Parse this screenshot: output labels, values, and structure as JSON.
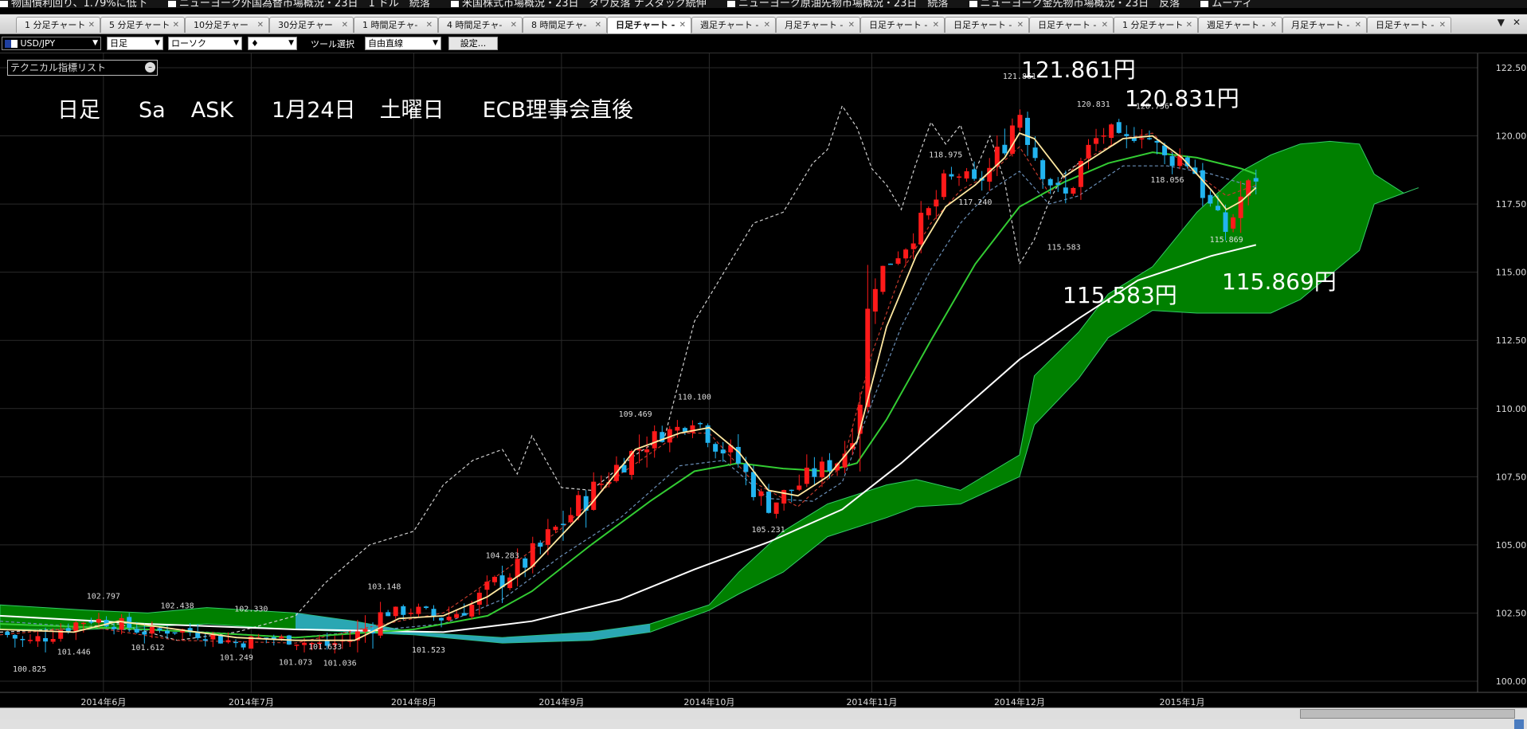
{
  "ticker": [
    "物国債利回り、1.79%に低下",
    "ニューヨーク外国為替市場概況・23日　1 ドル　続落",
    "米国株式市場概況・23日　ダウ反落 ナスダック続伸",
    "ニューヨーク原油先物市場概況・23日　続落",
    "ニューヨーク金先物市場概況・23日　反落",
    "ムーディ"
  ],
  "tabs": [
    {
      "label": "1 分足チャート"
    },
    {
      "label": "5 分足チャート"
    },
    {
      "label": "10分足チャー"
    },
    {
      "label": "30分足チャー"
    },
    {
      "label": "1 時間足チャ-"
    },
    {
      "label": "4 時間足チャ-"
    },
    {
      "label": "8 時間足チャ-"
    },
    {
      "label": "日足チャート -",
      "active": true
    },
    {
      "label": "週足チャート -"
    },
    {
      "label": "月足チャート -"
    },
    {
      "label": "日足チャート -"
    },
    {
      "label": "日足チャート -"
    },
    {
      "label": "日足チャート -"
    },
    {
      "label": "1 分足チャート"
    },
    {
      "label": "週足チャート -"
    },
    {
      "label": "月足チャート -"
    },
    {
      "label": "日足チャート -"
    }
  ],
  "toolbar": {
    "symbol": "USD/JPY",
    "timeframe": "日足",
    "chart_type": "ローソク",
    "tool_label": "ツール選択",
    "tool_value": "自由直線",
    "settings_button": "設定..."
  },
  "indicator_panel": {
    "title": "テクニカル指標リスト"
  },
  "annotation": {
    "timeframe": "日足",
    "day": "Sa",
    "side": "ASK",
    "date": "1月24日",
    "weekday": "土曜日",
    "note": "ECB理事会直後"
  },
  "big_labels": {
    "high1": "121.861円",
    "high2": "120.831円",
    "low1": "115.583円",
    "low2": "115.869円"
  },
  "colors": {
    "bull": "#ff1a1a",
    "bear": "#22b4f0",
    "cloud_bull": "#008000",
    "cloud_bear": "#2aa7b3",
    "ma_short": "#ffe8a0",
    "ma_mid": "#33cc33",
    "ma_long": "#ffffff"
  },
  "chart_data": {
    "type": "candlestick",
    "instrument": "USD/JPY",
    "timeframe": "daily",
    "y_ticks": [
      "122.50",
      "120.00",
      "117.50",
      "115.00",
      "112.50",
      "110.00",
      "107.50",
      "105.00",
      "102.50",
      "100.00"
    ],
    "ylim": [
      100.0,
      122.5
    ],
    "x_ticks": [
      "2014年6月",
      "2014年7月",
      "2014年8月",
      "2014年9月",
      "2014年10月",
      "2014年11月",
      "2014年12月",
      "2015年1月"
    ],
    "x_tick_pos": [
      0.07,
      0.17,
      0.28,
      0.38,
      0.48,
      0.59,
      0.69,
      0.8
    ],
    "price_labels": [
      {
        "text": "100.825",
        "x": 0.02,
        "y": 100.825
      },
      {
        "text": "101.446",
        "x": 0.05,
        "y": 101.446
      },
      {
        "text": "102.797",
        "x": 0.07,
        "y": 102.797
      },
      {
        "text": "101.612",
        "x": 0.1,
        "y": 101.612
      },
      {
        "text": "102.438",
        "x": 0.12,
        "y": 102.438
      },
      {
        "text": "101.249",
        "x": 0.16,
        "y": 101.249
      },
      {
        "text": "102.330",
        "x": 0.17,
        "y": 102.33
      },
      {
        "text": "101.073",
        "x": 0.2,
        "y": 101.073
      },
      {
        "text": "101.633",
        "x": 0.22,
        "y": 101.633
      },
      {
        "text": "101.036",
        "x": 0.23,
        "y": 101.036
      },
      {
        "text": "103.148",
        "x": 0.26,
        "y": 103.148
      },
      {
        "text": "101.523",
        "x": 0.29,
        "y": 101.523
      },
      {
        "text": "104.283",
        "x": 0.34,
        "y": 104.283
      },
      {
        "text": "109.469",
        "x": 0.43,
        "y": 109.469
      },
      {
        "text": "110.100",
        "x": 0.47,
        "y": 110.1
      },
      {
        "text": "105.231",
        "x": 0.52,
        "y": 105.231
      },
      {
        "text": "118.975",
        "x": 0.64,
        "y": 118.975
      },
      {
        "text": "117.240",
        "x": 0.66,
        "y": 117.24
      },
      {
        "text": "121.861",
        "x": 0.69,
        "y": 121.861
      },
      {
        "text": "115.583",
        "x": 0.72,
        "y": 115.583
      },
      {
        "text": "120.831",
        "x": 0.74,
        "y": 120.831
      },
      {
        "text": "120.756",
        "x": 0.78,
        "y": 120.756
      },
      {
        "text": "118.056",
        "x": 0.79,
        "y": 118.056
      },
      {
        "text": "115.869",
        "x": 0.83,
        "y": 115.869
      }
    ],
    "close_path": [
      [
        0.0,
        101.8
      ],
      [
        0.02,
        101.4
      ],
      [
        0.04,
        101.9
      ],
      [
        0.06,
        102.3
      ],
      [
        0.08,
        102.1
      ],
      [
        0.1,
        101.8
      ],
      [
        0.12,
        101.9
      ],
      [
        0.14,
        101.7
      ],
      [
        0.16,
        101.4
      ],
      [
        0.18,
        101.6
      ],
      [
        0.2,
        101.5
      ],
      [
        0.22,
        101.3
      ],
      [
        0.24,
        101.6
      ],
      [
        0.26,
        102.5
      ],
      [
        0.28,
        102.6
      ],
      [
        0.3,
        102.3
      ],
      [
        0.32,
        102.8
      ],
      [
        0.34,
        103.8
      ],
      [
        0.36,
        104.5
      ],
      [
        0.38,
        105.8
      ],
      [
        0.4,
        106.9
      ],
      [
        0.42,
        108.0
      ],
      [
        0.44,
        108.9
      ],
      [
        0.46,
        109.3
      ],
      [
        0.47,
        109.7
      ],
      [
        0.48,
        109.0
      ],
      [
        0.5,
        108.0
      ],
      [
        0.51,
        107.1
      ],
      [
        0.52,
        106.4
      ],
      [
        0.53,
        106.8
      ],
      [
        0.55,
        107.6
      ],
      [
        0.57,
        108.2
      ],
      [
        0.58,
        110.0
      ],
      [
        0.59,
        114.5
      ],
      [
        0.6,
        115.3
      ],
      [
        0.61,
        115.8
      ],
      [
        0.62,
        116.6
      ],
      [
        0.63,
        117.3
      ],
      [
        0.64,
        118.3
      ],
      [
        0.65,
        118.6
      ],
      [
        0.66,
        118.2
      ],
      [
        0.67,
        118.8
      ],
      [
        0.68,
        119.8
      ],
      [
        0.69,
        121.0
      ],
      [
        0.7,
        119.4
      ],
      [
        0.71,
        118.4
      ],
      [
        0.72,
        117.6
      ],
      [
        0.73,
        118.8
      ],
      [
        0.74,
        119.8
      ],
      [
        0.75,
        120.2
      ],
      [
        0.76,
        119.6
      ],
      [
        0.77,
        120.3
      ],
      [
        0.78,
        119.8
      ],
      [
        0.79,
        119.0
      ],
      [
        0.8,
        119.3
      ],
      [
        0.81,
        118.6
      ],
      [
        0.82,
        117.2
      ],
      [
        0.83,
        116.5
      ],
      [
        0.84,
        117.8
      ],
      [
        0.85,
        118.5
      ]
    ],
    "ma_short": [
      [
        0.0,
        101.9
      ],
      [
        0.05,
        101.8
      ],
      [
        0.08,
        102.2
      ],
      [
        0.12,
        101.9
      ],
      [
        0.16,
        101.6
      ],
      [
        0.2,
        101.5
      ],
      [
        0.24,
        101.5
      ],
      [
        0.27,
        102.3
      ],
      [
        0.3,
        102.4
      ],
      [
        0.33,
        103.1
      ],
      [
        0.36,
        104.2
      ],
      [
        0.4,
        106.5
      ],
      [
        0.43,
        108.5
      ],
      [
        0.46,
        109.1
      ],
      [
        0.48,
        109.3
      ],
      [
        0.5,
        108.4
      ],
      [
        0.52,
        107.0
      ],
      [
        0.54,
        106.8
      ],
      [
        0.56,
        107.5
      ],
      [
        0.58,
        108.8
      ],
      [
        0.6,
        113.0
      ],
      [
        0.62,
        115.6
      ],
      [
        0.64,
        117.4
      ],
      [
        0.66,
        118.2
      ],
      [
        0.68,
        119.2
      ],
      [
        0.69,
        120.1
      ],
      [
        0.7,
        119.9
      ],
      [
        0.72,
        118.5
      ],
      [
        0.74,
        119.2
      ],
      [
        0.76,
        119.9
      ],
      [
        0.78,
        120.0
      ],
      [
        0.8,
        119.2
      ],
      [
        0.82,
        118.0
      ],
      [
        0.83,
        117.3
      ],
      [
        0.84,
        117.6
      ],
      [
        0.85,
        118.1
      ]
    ],
    "ma_mid": [
      [
        0.0,
        102.1
      ],
      [
        0.1,
        101.9
      ],
      [
        0.2,
        101.6
      ],
      [
        0.28,
        101.9
      ],
      [
        0.33,
        102.4
      ],
      [
        0.36,
        103.3
      ],
      [
        0.4,
        105.0
      ],
      [
        0.44,
        106.6
      ],
      [
        0.47,
        107.7
      ],
      [
        0.5,
        108.0
      ],
      [
        0.53,
        107.8
      ],
      [
        0.56,
        107.7
      ],
      [
        0.58,
        108.0
      ],
      [
        0.6,
        109.6
      ],
      [
        0.63,
        112.5
      ],
      [
        0.66,
        115.3
      ],
      [
        0.69,
        117.4
      ],
      [
        0.72,
        118.3
      ],
      [
        0.75,
        119.0
      ],
      [
        0.78,
        119.4
      ],
      [
        0.81,
        119.2
      ],
      [
        0.84,
        118.8
      ],
      [
        0.85,
        118.6
      ]
    ],
    "ma_long": [
      [
        0.0,
        102.4
      ],
      [
        0.1,
        102.1
      ],
      [
        0.2,
        101.9
      ],
      [
        0.3,
        101.8
      ],
      [
        0.36,
        102.2
      ],
      [
        0.42,
        103.0
      ],
      [
        0.47,
        104.1
      ],
      [
        0.52,
        105.1
      ],
      [
        0.57,
        106.3
      ],
      [
        0.61,
        108.0
      ],
      [
        0.65,
        109.9
      ],
      [
        0.69,
        111.8
      ],
      [
        0.73,
        113.3
      ],
      [
        0.77,
        114.7
      ],
      [
        0.82,
        115.6
      ],
      [
        0.85,
        116.0
      ]
    ],
    "cloud_top": [
      [
        0.0,
        102.8
      ],
      [
        0.06,
        102.6
      ],
      [
        0.1,
        102.5
      ],
      [
        0.14,
        102.7
      ],
      [
        0.2,
        102.5
      ],
      [
        0.24,
        102.2
      ],
      [
        0.28,
        101.8
      ],
      [
        0.34,
        101.6
      ],
      [
        0.4,
        101.8
      ],
      [
        0.44,
        102.1
      ],
      [
        0.48,
        102.8
      ],
      [
        0.5,
        104.0
      ],
      [
        0.53,
        105.5
      ],
      [
        0.56,
        106.5
      ],
      [
        0.6,
        107.2
      ],
      [
        0.62,
        107.4
      ],
      [
        0.65,
        107.0
      ],
      [
        0.69,
        108.3
      ],
      [
        0.7,
        111.2
      ],
      [
        0.73,
        112.8
      ],
      [
        0.75,
        114.2
      ],
      [
        0.78,
        115.2
      ],
      [
        0.81,
        117.2
      ],
      [
        0.84,
        118.7
      ],
      [
        0.86,
        119.3
      ],
      [
        0.88,
        119.7
      ],
      [
        0.9,
        119.8
      ],
      [
        0.92,
        119.7
      ],
      [
        0.93,
        118.6
      ],
      [
        0.95,
        117.9
      ],
      [
        0.96,
        118.1
      ]
    ],
    "cloud_bottom": [
      [
        0.0,
        101.9
      ],
      [
        0.06,
        101.9
      ],
      [
        0.1,
        102.0
      ],
      [
        0.14,
        102.1
      ],
      [
        0.2,
        101.9
      ],
      [
        0.24,
        101.8
      ],
      [
        0.28,
        101.7
      ],
      [
        0.34,
        101.4
      ],
      [
        0.4,
        101.5
      ],
      [
        0.44,
        101.8
      ],
      [
        0.48,
        102.6
      ],
      [
        0.5,
        103.2
      ],
      [
        0.53,
        104.0
      ],
      [
        0.56,
        105.3
      ],
      [
        0.6,
        106.0
      ],
      [
        0.62,
        106.4
      ],
      [
        0.65,
        106.5
      ],
      [
        0.69,
        107.5
      ],
      [
        0.7,
        109.4
      ],
      [
        0.73,
        111.1
      ],
      [
        0.75,
        112.6
      ],
      [
        0.78,
        113.6
      ],
      [
        0.81,
        113.5
      ],
      [
        0.84,
        113.5
      ],
      [
        0.86,
        113.5
      ],
      [
        0.88,
        114.0
      ],
      [
        0.9,
        114.9
      ],
      [
        0.92,
        115.8
      ],
      [
        0.93,
        117.5
      ],
      [
        0.95,
        117.9
      ],
      [
        0.96,
        118.1
      ]
    ],
    "lagging_span": [
      [
        0.0,
        101.8
      ],
      [
        0.04,
        101.9
      ],
      [
        0.08,
        102.1
      ],
      [
        0.12,
        101.5
      ],
      [
        0.16,
        101.8
      ],
      [
        0.2,
        102.4
      ],
      [
        0.22,
        103.6
      ],
      [
        0.25,
        105.0
      ],
      [
        0.28,
        105.5
      ],
      [
        0.3,
        107.2
      ],
      [
        0.32,
        108.1
      ],
      [
        0.34,
        108.5
      ],
      [
        0.35,
        107.6
      ],
      [
        0.36,
        109.0
      ],
      [
        0.38,
        107.1
      ],
      [
        0.4,
        107.0
      ],
      [
        0.43,
        108.3
      ],
      [
        0.45,
        109.0
      ],
      [
        0.47,
        113.2
      ],
      [
        0.49,
        115.0
      ],
      [
        0.51,
        116.8
      ],
      [
        0.53,
        117.2
      ],
      [
        0.55,
        119.0
      ],
      [
        0.56,
        119.5
      ],
      [
        0.57,
        121.1
      ],
      [
        0.58,
        120.3
      ],
      [
        0.59,
        118.8
      ],
      [
        0.6,
        118.2
      ],
      [
        0.61,
        117.3
      ],
      [
        0.62,
        119.0
      ],
      [
        0.63,
        120.5
      ],
      [
        0.64,
        119.7
      ],
      [
        0.65,
        120.4
      ],
      [
        0.66,
        118.7
      ],
      [
        0.67,
        120.0
      ],
      [
        0.68,
        118.3
      ],
      [
        0.69,
        115.3
      ],
      [
        0.7,
        116.2
      ],
      [
        0.71,
        117.6
      ],
      [
        0.72,
        118.6
      ],
      [
        0.73,
        119.0
      ]
    ],
    "baseline": [
      [
        0.0,
        102.2
      ],
      [
        0.08,
        101.9
      ],
      [
        0.14,
        101.8
      ],
      [
        0.2,
        101.6
      ],
      [
        0.26,
        101.9
      ],
      [
        0.3,
        102.1
      ],
      [
        0.34,
        103.0
      ],
      [
        0.38,
        104.6
      ],
      [
        0.42,
        106.0
      ],
      [
        0.46,
        107.9
      ],
      [
        0.49,
        108.1
      ],
      [
        0.52,
        106.7
      ],
      [
        0.55,
        106.6
      ],
      [
        0.57,
        107.3
      ],
      [
        0.59,
        110.2
      ],
      [
        0.61,
        113.0
      ],
      [
        0.63,
        115.1
      ],
      [
        0.65,
        116.8
      ],
      [
        0.67,
        118.0
      ],
      [
        0.69,
        118.7
      ],
      [
        0.71,
        117.5
      ],
      [
        0.73,
        117.8
      ],
      [
        0.76,
        118.9
      ],
      [
        0.79,
        118.9
      ],
      [
        0.82,
        118.6
      ],
      [
        0.85,
        118.1
      ]
    ],
    "conversion": [
      [
        0.0,
        101.7
      ],
      [
        0.06,
        102.0
      ],
      [
        0.12,
        101.5
      ],
      [
        0.2,
        101.4
      ],
      [
        0.26,
        102.1
      ],
      [
        0.3,
        102.5
      ],
      [
        0.34,
        104.0
      ],
      [
        0.38,
        105.6
      ],
      [
        0.42,
        107.6
      ],
      [
        0.46,
        109.1
      ],
      [
        0.48,
        109.1
      ],
      [
        0.51,
        107.3
      ],
      [
        0.54,
        106.4
      ],
      [
        0.57,
        107.9
      ],
      [
        0.59,
        112.0
      ],
      [
        0.61,
        115.0
      ],
      [
        0.63,
        116.8
      ],
      [
        0.65,
        118.0
      ],
      [
        0.67,
        118.6
      ],
      [
        0.69,
        119.6
      ],
      [
        0.71,
        117.9
      ],
      [
        0.73,
        119.0
      ],
      [
        0.76,
        119.9
      ],
      [
        0.78,
        120.1
      ],
      [
        0.8,
        119.0
      ],
      [
        0.83,
        117.8
      ],
      [
        0.85,
        118.2
      ]
    ]
  }
}
